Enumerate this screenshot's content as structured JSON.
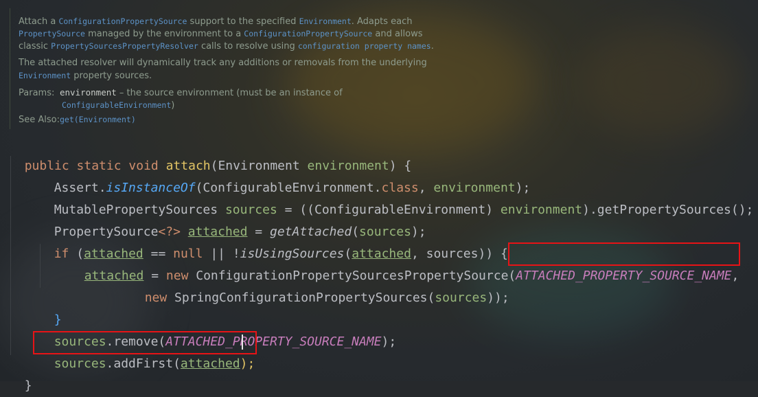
{
  "doc": {
    "para1_line1": {
      "t1": "Attach a ",
      "c1": "ConfigurationPropertySource",
      "t2": " support to the specified ",
      "c2": "Environment",
      "t3": ". Adapts each"
    },
    "para1_line2": {
      "c1": "PropertySource",
      "t1": " managed by the environment to a ",
      "c2": "ConfigurationPropertySource",
      "t2": " and allows"
    },
    "para1_line3": {
      "t1": "classic ",
      "c1": "PropertySourcesPropertyResolver",
      "t2": " calls to resolve using ",
      "c2": "configuration property names",
      "t3": "."
    },
    "para2_line1": "The attached resolver will dynamically track any additions or removals from the underlying",
    "para2_line2": {
      "c1": "Environment",
      "t1": " property sources."
    },
    "params_label": "Params:",
    "params_term": "environment",
    "params_desc": " – the source environment (must be an instance of",
    "params_type": "ConfigurableEnvironment",
    "params_close": ")",
    "see_also_label": "See Also:",
    "see_also_link": "get(Environment)"
  },
  "code": {
    "l1": {
      "kw": "public static void ",
      "fn": "attach",
      "p1": "(Environment ",
      "param": "environment",
      "p2": ") {"
    },
    "l2": {
      "t1": "Assert.",
      "m": "isInstanceOf",
      "t2": "(ConfigurableEnvironment.",
      "kw": "class",
      "t3": ", ",
      "param": "environment",
      "t4": ");"
    },
    "l3": {
      "t1": "MutablePropertySources ",
      "v": "sources",
      "t2": " = ((ConfigurableEnvironment) ",
      "param": "environment",
      "t3": ").getPropertySources();"
    },
    "l4": {
      "t1": "PropertySource",
      "g": "<?>",
      "sp": " ",
      "v": "attached",
      "t2": " = ",
      "m": "getAttached",
      "t3": "(",
      "v2": "sources",
      "t4": ");"
    },
    "l5": {
      "kw": "if",
      "t0": " (",
      "v": "attached",
      "op": " == ",
      "kw2": "null",
      "t1": " || !",
      "m": "isUsingSources",
      "t2": "(",
      "v2": "attached",
      "t3": ", ",
      "v3": "sources",
      "t4": ")) {"
    },
    "l6": {
      "v": "attached",
      "t1": " = ",
      "kw": "new",
      "t2": " ConfigurationPropertySourcesPropertySource(",
      "c": "ATTACHED_PROPERTY_SOURCE_NAME",
      "t3": ","
    },
    "l7": {
      "kw": "new",
      "t1": " SpringConfigurationPropertySources(",
      "v": "sources",
      "t2": "));"
    },
    "l8": {
      "t1": "}"
    },
    "l9": {
      "v": "sources",
      "t1": ".remove(",
      "c": "ATTACHED_PROPERTY_SOURCE_NAME",
      "t2": ");"
    },
    "l10": {
      "v": "sources",
      "t1": ".addFirst(",
      "v2": "attached",
      "t2": ");"
    },
    "l11": {
      "t1": "}"
    }
  },
  "colors": {
    "keyword": "#cf8e6d",
    "method": "#56a8f5",
    "variable": "#98b77b",
    "constant": "#c77dbb",
    "highlight_box": "#e81316"
  }
}
